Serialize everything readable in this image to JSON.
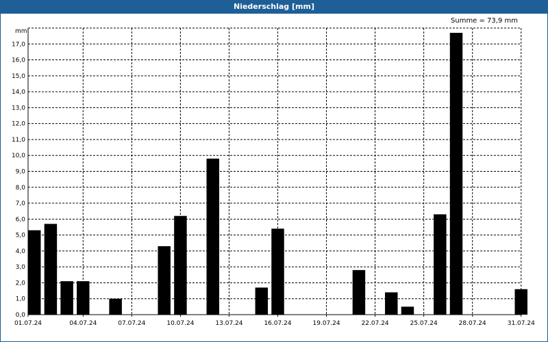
{
  "chart_data": {
    "type": "bar",
    "title": "Niederschlag [mm]",
    "ylabel": "mm",
    "annotation": "Summe = 73,9 mm",
    "ylim": [
      0,
      18
    ],
    "yticks": [
      "0,0",
      "1,0",
      "2,0",
      "3,0",
      "4,0",
      "5,0",
      "6,0",
      "7,0",
      "8,0",
      "9,0",
      "10,0",
      "11,0",
      "12,0",
      "13,0",
      "14,0",
      "15,0",
      "16,0",
      "17,0"
    ],
    "xtick_labels": [
      "01.07.24",
      "04.07.24",
      "07.07.24",
      "10.07.24",
      "13.07.24",
      "16.07.24",
      "19.07.24",
      "22.07.24",
      "25.07.24",
      "28.07.24",
      "31.07.24"
    ],
    "categories": [
      "01.07.24",
      "02.07.24",
      "03.07.24",
      "04.07.24",
      "05.07.24",
      "06.07.24",
      "07.07.24",
      "08.07.24",
      "09.07.24",
      "10.07.24",
      "11.07.24",
      "12.07.24",
      "13.07.24",
      "14.07.24",
      "15.07.24",
      "16.07.24",
      "17.07.24",
      "18.07.24",
      "19.07.24",
      "20.07.24",
      "21.07.24",
      "22.07.24",
      "23.07.24",
      "24.07.24",
      "25.07.24",
      "26.07.24",
      "27.07.24",
      "28.07.24",
      "29.07.24",
      "30.07.24",
      "31.07.24"
    ],
    "values": [
      5.3,
      5.7,
      2.1,
      2.1,
      0,
      1.0,
      0,
      0,
      4.3,
      6.2,
      0,
      9.8,
      0,
      0,
      1.7,
      5.4,
      0,
      0,
      0,
      0,
      2.8,
      0,
      1.4,
      0.5,
      0,
      6.3,
      17.7,
      0,
      0,
      0,
      1.6
    ],
    "grid": true,
    "bar_color": "#000000",
    "title_bar_color": "#1f5f97"
  }
}
